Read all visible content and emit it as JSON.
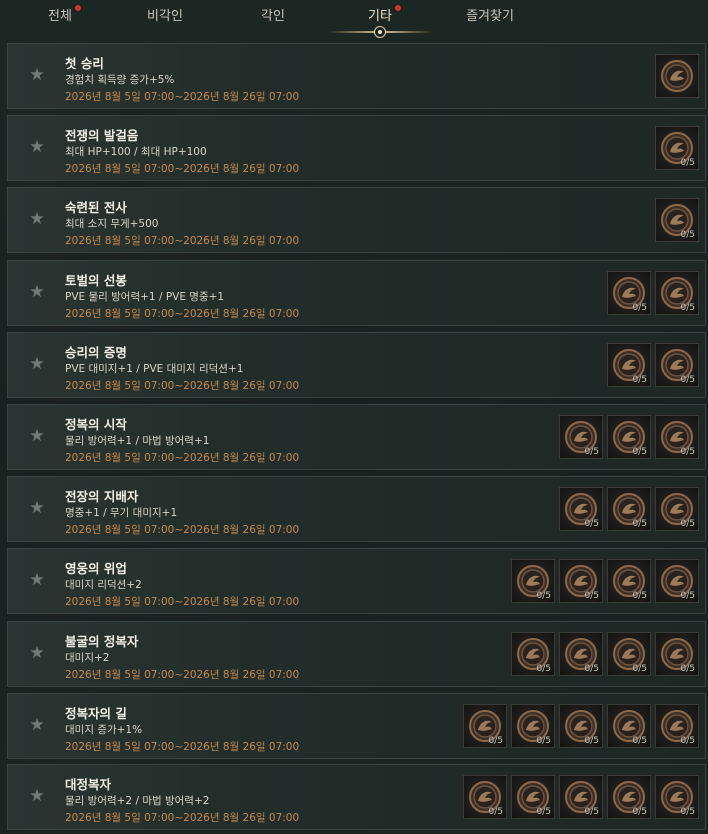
{
  "tabs": [
    {
      "label": "전체",
      "has_dot": true,
      "active": false
    },
    {
      "label": "비각인",
      "has_dot": false,
      "active": false
    },
    {
      "label": "각인",
      "has_dot": false,
      "active": false
    },
    {
      "label": "기타",
      "has_dot": true,
      "active": true
    },
    {
      "label": "즐겨찾기",
      "has_dot": false,
      "active": false
    }
  ],
  "colors": {
    "accent": "#d9c590",
    "period": "#c58a4a",
    "dot": "#d8332b"
  },
  "rows": [
    {
      "title": "첫 승리",
      "effect": "경험치 획득량 증가+5%",
      "period": "2026년 8월 5일 07:00~2026년 8월 26일 07:00",
      "medals": [
        ""
      ]
    },
    {
      "title": "전쟁의 발걸음",
      "effect": "최대 HP+100 / 최대 HP+100",
      "period": "2026년 8월 5일 07:00~2026년 8월 26일 07:00",
      "medals": [
        "0/5"
      ]
    },
    {
      "title": "숙련된 전사",
      "effect": "최대 소지 무게+500",
      "period": "2026년 8월 5일 07:00~2026년 8월 26일 07:00",
      "medals": [
        "0/5"
      ]
    },
    {
      "title": "토벌의 선봉",
      "effect": "PVE 물리 방어력+1 / PVE 명중+1",
      "period": "2026년 8월 5일 07:00~2026년 8월 26일 07:00",
      "medals": [
        "0/5",
        "0/5"
      ]
    },
    {
      "title": "승리의 증명",
      "effect": "PVE 대미지+1 / PVE 대미지 리덕션+1",
      "period": "2026년 8월 5일 07:00~2026년 8월 26일 07:00",
      "medals": [
        "0/5",
        "0/5"
      ]
    },
    {
      "title": "정복의 시작",
      "effect": "물리 방어력+1 / 마법 방어력+1",
      "period": "2026년 8월 5일 07:00~2026년 8월 26일 07:00",
      "medals": [
        "0/5",
        "0/5",
        "0/5"
      ]
    },
    {
      "title": "전장의 지배자",
      "effect": "명중+1 / 무기 대미지+1",
      "period": "2026년 8월 5일 07:00~2026년 8월 26일 07:00",
      "medals": [
        "0/5",
        "0/5",
        "0/5"
      ]
    },
    {
      "title": "영웅의 위업",
      "effect": "대미지 리덕션+2",
      "period": "2026년 8월 5일 07:00~2026년 8월 26일 07:00",
      "medals": [
        "0/5",
        "0/5",
        "0/5",
        "0/5"
      ]
    },
    {
      "title": "불굴의 정복자",
      "effect": "대미지+2",
      "period": "2026년 8월 5일 07:00~2026년 8월 26일 07:00",
      "medals": [
        "0/5",
        "0/5",
        "0/5",
        "0/5"
      ]
    },
    {
      "title": "정복자의 길",
      "effect": "대미지 증가+1%",
      "period": "2026년 8월 5일 07:00~2026년 8월 26일 07:00",
      "medals": [
        "0/5",
        "0/5",
        "0/5",
        "0/5",
        "0/5"
      ]
    },
    {
      "title": "대정복자",
      "effect": "물리 방어력+2 / 마법 방어력+2",
      "period": "2026년 8월 5일 07:00~2026년 8월 26일 07:00",
      "medals": [
        "0/5",
        "0/5",
        "0/5",
        "0/5",
        "0/5"
      ]
    }
  ]
}
